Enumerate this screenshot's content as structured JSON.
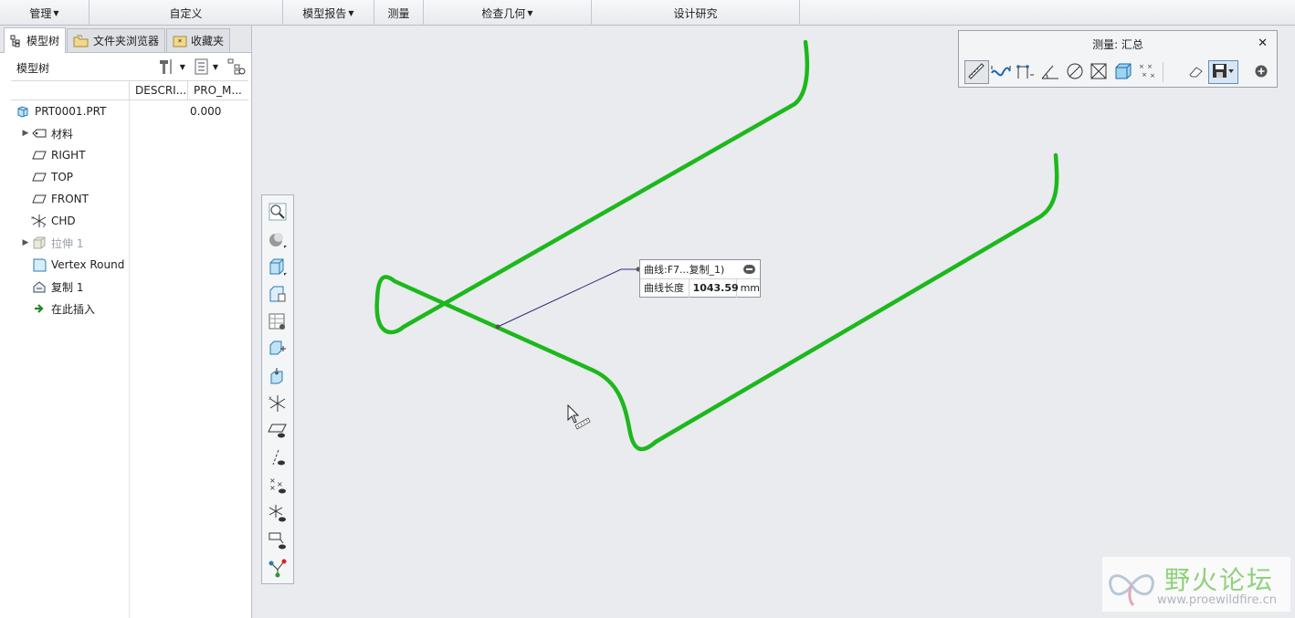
{
  "ribbon": {
    "groups": [
      {
        "label": "管理",
        "dropdown": true
      },
      {
        "label": "自定义",
        "dropdown": false
      },
      {
        "label": "模型报告",
        "dropdown": true
      },
      {
        "label": "测量",
        "dropdown": false
      },
      {
        "label": "检查几何",
        "dropdown": true
      },
      {
        "label": "设计研究",
        "dropdown": false
      }
    ]
  },
  "left_panel": {
    "tabs": [
      {
        "label": "模型树",
        "icon": "model-tree-icon",
        "active": true
      },
      {
        "label": "文件夹浏览器",
        "icon": "folder-browser-icon",
        "active": false
      },
      {
        "label": "收藏夹",
        "icon": "favorites-icon",
        "active": false
      }
    ],
    "tree_title": "模型树",
    "columns": [
      "DESCRI...",
      "PRO_M..."
    ],
    "tree": [
      {
        "label": "PRT0001.PRT",
        "icon": "part-icon",
        "value": "0.000",
        "expandable": false
      },
      {
        "label": "材料",
        "icon": "material-icon",
        "expandable": true
      },
      {
        "label": "RIGHT",
        "icon": "datum-plane-icon",
        "expandable": false
      },
      {
        "label": "TOP",
        "icon": "datum-plane-icon",
        "expandable": false
      },
      {
        "label": "FRONT",
        "icon": "datum-plane-icon",
        "expandable": false
      },
      {
        "label": "CHD",
        "icon": "coordinate-system-icon",
        "expandable": false
      },
      {
        "label": "拉伸 1",
        "icon": "extrude-icon",
        "expandable": true,
        "dim": true
      },
      {
        "label": "Vertex Round",
        "icon": "round-icon",
        "expandable": false
      },
      {
        "label": "复制 1",
        "icon": "copy-icon",
        "expandable": false
      },
      {
        "label": "在此插入",
        "icon": "insert-here-icon",
        "expandable": false
      }
    ]
  },
  "measure_dialog": {
    "title": "测量: 汇总",
    "tools": [
      "distance-measure-icon",
      "length-measure-icon",
      "curve-length-icon",
      "angle-measure-icon",
      "diameter-measure-icon",
      "area-measure-icon",
      "volume-measure-icon",
      "transform-icon"
    ],
    "extra": [
      "eraser-icon",
      "save-icon",
      "add-icon"
    ]
  },
  "callout": {
    "header": "曲线:F7...复制_1)",
    "label": "曲线长度",
    "value": "1043.59",
    "unit": "mm"
  },
  "watermark": {
    "text": "野火论坛",
    "url": "www.proewildfire.cn"
  },
  "colors": {
    "curve": "#1cb81c",
    "canvas": "#e9ebee"
  }
}
